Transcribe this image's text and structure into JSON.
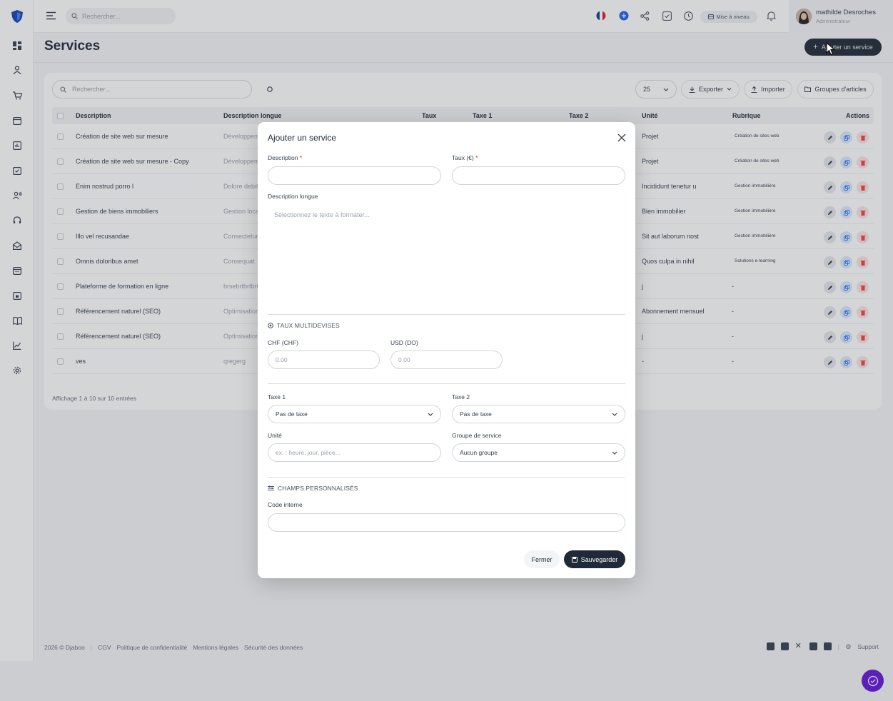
{
  "topbar": {
    "search_placeholder": "Rechercher...",
    "upgrade_label": "Mise à niveau",
    "user_name": "mathilde Desroches",
    "user_role": "Administrateur"
  },
  "page": {
    "title": "Services",
    "add_button": "Ajouter un service"
  },
  "table": {
    "search_placeholder": "Rechercher...",
    "per_page": "25",
    "export_label": "Exporter",
    "import_label": "Importer",
    "groups_label": "Groupes d'articles",
    "columns": [
      "Description",
      "Description longue",
      "Taux",
      "Taxe 1",
      "Taxe 2",
      "Unité",
      "Rubrique",
      "Actions"
    ],
    "rows": [
      {
        "description": "Création de site web sur mesure",
        "long": "Développement",
        "unit": "Projet",
        "rubrique": "Création de sites web"
      },
      {
        "description": "Création de site web sur mesure - Copy",
        "long": "Développement",
        "unit": "Projet",
        "rubrique": "Création de sites web"
      },
      {
        "description": "Enim nostrud porro l",
        "long": "Dolore debitis",
        "unit": "Incididunt tenetur u",
        "rubrique": "Gestion immobilière"
      },
      {
        "description": "Gestion de biens immobiliers",
        "long": "Gestion locative",
        "unit": "Bien immobilier",
        "rubrique": "Gestion immobilière"
      },
      {
        "description": "Illo vel recusandae",
        "long": "Consectetur",
        "unit": "Sit aut laborum nost",
        "rubrique": "Gestion immobilière"
      },
      {
        "description": "Omnis doloribus amet",
        "long": "Consequat",
        "unit": "Quos culpa in nihil",
        "rubrique": "Solutions e-learning"
      },
      {
        "description": "Plateforme de formation en ligne",
        "long": "brsebrtbrtbrt",
        "unit": "j",
        "rubrique": "-"
      },
      {
        "description": "Référencement naturel (SEO)",
        "long": "Optimisation",
        "unit": "Abonnement mensuel",
        "rubrique": "-"
      },
      {
        "description": "Référencement naturel (SEO)",
        "long": "Optimisation",
        "unit": "j",
        "rubrique": "-"
      },
      {
        "description": "ves",
        "long": "qregerg",
        "unit": "-",
        "rubrique": "-"
      }
    ],
    "info": "Affichage 1 à 10 sur 10 entrées"
  },
  "modal": {
    "title": "Ajouter un service",
    "description_label": "Description",
    "rate_label": "Taux (€)",
    "required_mark": "*",
    "long_description_label": "Description longue",
    "editor_placeholder": "Sélectionnez le texte à formater...",
    "multicurrency_title": "TAUX MULTIDEVISES",
    "chf_label": "CHF (CHF)",
    "usd_label": "USD (DO)",
    "chf_placeholder": "0.00",
    "usd_placeholder": "0.00",
    "tax1_label": "Taxe 1",
    "tax2_label": "Taxe 2",
    "tax1_value": "Pas de taxe",
    "tax2_value": "Pas de taxe",
    "unit_label": "Unité",
    "unit_placeholder": "ex. : heure, jour, pièce...",
    "group_label": "Groupe de service",
    "group_value": "Aucun groupe",
    "custom_fields_title": "CHAMPS PERSONNALISÉS",
    "internal_code_label": "Code interne",
    "close_button": "Fermer",
    "save_button": "Sauvegarder"
  },
  "footer": {
    "copyright": "2026 © Djaboo",
    "links": [
      "CGV",
      "Politique de confidentialité",
      "Mentions légales",
      "Sécurité des données"
    ],
    "support": "Support"
  },
  "colors": {
    "primary_dark": "#1f2937",
    "danger": "#dc2626",
    "chat": "#5b21b6"
  }
}
